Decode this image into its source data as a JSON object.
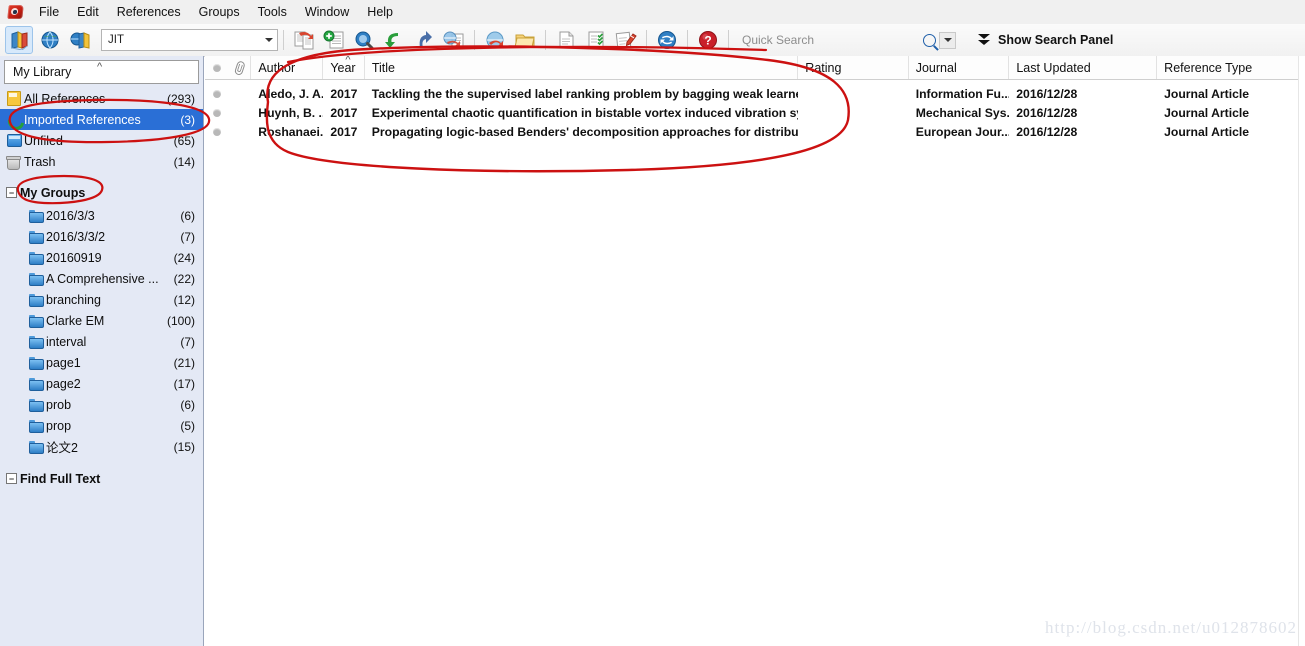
{
  "app": {
    "logo_icon": "endnote-logo-icon"
  },
  "menu": {
    "items": [
      {
        "label": "File"
      },
      {
        "label": "Edit"
      },
      {
        "label": "References"
      },
      {
        "label": "Groups"
      },
      {
        "label": "Tools"
      },
      {
        "label": "Window"
      },
      {
        "label": "Help"
      }
    ]
  },
  "toolbar": {
    "style_combo": {
      "value": "JIT",
      "icon": "chevron-down-icon"
    },
    "buttons": [
      {
        "name": "open-library-icon",
        "title": "Open Library"
      },
      {
        "name": "online-search-icon",
        "title": "Online Search"
      },
      {
        "name": "integrated-library-icon",
        "title": "Integrated Library & Online Search"
      },
      {
        "name": "copy-to-local-icon",
        "title": "Copy to Local Library"
      },
      {
        "name": "new-reference-icon",
        "title": "New Reference"
      },
      {
        "name": "search-references-icon",
        "title": "Search References"
      },
      {
        "name": "sync-down-icon",
        "title": "Import"
      },
      {
        "name": "export-up-icon",
        "title": "Export"
      },
      {
        "name": "online-mode-icon",
        "title": "Online Mode"
      },
      {
        "name": "find-full-text-icon",
        "title": "Find Full Text"
      },
      {
        "name": "open-file-icon",
        "title": "Open File"
      },
      {
        "name": "new-page-icon",
        "title": "New Page"
      },
      {
        "name": "format-bibliography-icon",
        "title": "Format Bibliography"
      },
      {
        "name": "edit-citation-icon",
        "title": "Edit Citation"
      },
      {
        "name": "sync-icon",
        "title": "Sync"
      },
      {
        "name": "help-icon",
        "title": "Help"
      }
    ],
    "search": {
      "placeholder": "Quick Search",
      "magnifier_icon": "search-icon",
      "dropdown_icon": "chevron-down-icon"
    },
    "show_search_panel": {
      "label": "Show Search Panel",
      "icon": "double-chevron-down-icon"
    }
  },
  "sidebar": {
    "library_header": "My Library",
    "nav": [
      {
        "label": "All References",
        "count": "(293)",
        "icon": "all-references-icon",
        "selected": false
      },
      {
        "label": "Imported References",
        "count": "(3)",
        "icon": "imported-references-icon",
        "selected": true
      },
      {
        "label": "Unfiled",
        "count": "(65)",
        "icon": "unfiled-icon",
        "selected": false
      },
      {
        "label": "Trash",
        "count": "(14)",
        "icon": "trash-icon",
        "selected": false
      }
    ],
    "my_groups_header": "My Groups",
    "groups": [
      {
        "label": "2016/3/3",
        "count": "(6)"
      },
      {
        "label": "2016/3/3/2",
        "count": "(7)"
      },
      {
        "label": "20160919",
        "count": "(24)"
      },
      {
        "label": "A Comprehensive ...",
        "count": "(22)"
      },
      {
        "label": "branching",
        "count": "(12)"
      },
      {
        "label": "Clarke EM",
        "count": "(100)"
      },
      {
        "label": "interval",
        "count": "(7)"
      },
      {
        "label": "page1",
        "count": "(21)"
      },
      {
        "label": "page2",
        "count": "(17)"
      },
      {
        "label": "prob",
        "count": "(6)"
      },
      {
        "label": "prop",
        "count": "(5)"
      },
      {
        "label": "论文2",
        "count": "(15)"
      }
    ],
    "find_full_text_header": "Find Full Text"
  },
  "table": {
    "columns": [
      {
        "key": "dot",
        "label": ""
      },
      {
        "key": "clip",
        "label": ""
      },
      {
        "key": "author",
        "label": "Author"
      },
      {
        "key": "year",
        "label": "Year",
        "sorted": "asc"
      },
      {
        "key": "title",
        "label": "Title"
      },
      {
        "key": "rating",
        "label": "Rating"
      },
      {
        "key": "journal",
        "label": "Journal"
      },
      {
        "key": "updated",
        "label": "Last Updated"
      },
      {
        "key": "reftype",
        "label": "Reference Type"
      }
    ],
    "rows": [
      {
        "author": "Aledo, J. A...",
        "year": "2017",
        "title": "Tackling the the supervised label ranking problem by bagging weak learners",
        "rating": "",
        "journal": "Information Fu...",
        "updated": "2016/12/28",
        "reftype": "Journal Article"
      },
      {
        "author": "Huynh, B. ...",
        "year": "2017",
        "title": "Experimental chaotic quantification in bistable vortex induced vibration syst...",
        "rating": "",
        "journal": "Mechanical Sys...",
        "updated": "2016/12/28",
        "reftype": "Journal Article"
      },
      {
        "author": "Roshanaei...",
        "year": "2017",
        "title": "Propagating logic-based Benders' decomposition approaches for distributed...",
        "rating": "",
        "journal": "European Jour...",
        "updated": "2016/12/28",
        "reftype": "Journal Article"
      }
    ]
  },
  "annotations": {
    "color": "#cc1111",
    "shapes": [
      {
        "name": "annotation-ellipse-imported-references"
      },
      {
        "name": "annotation-ellipse-my-groups"
      },
      {
        "name": "annotation-ellipse-reference-list"
      }
    ]
  },
  "watermark": {
    "text": "http://blog.csdn.net/u012878602"
  },
  "colors": {
    "selection_blue": "#2a6fd6",
    "sidebar_bg": "#e4e9f5",
    "annotation_red": "#cc1111"
  }
}
